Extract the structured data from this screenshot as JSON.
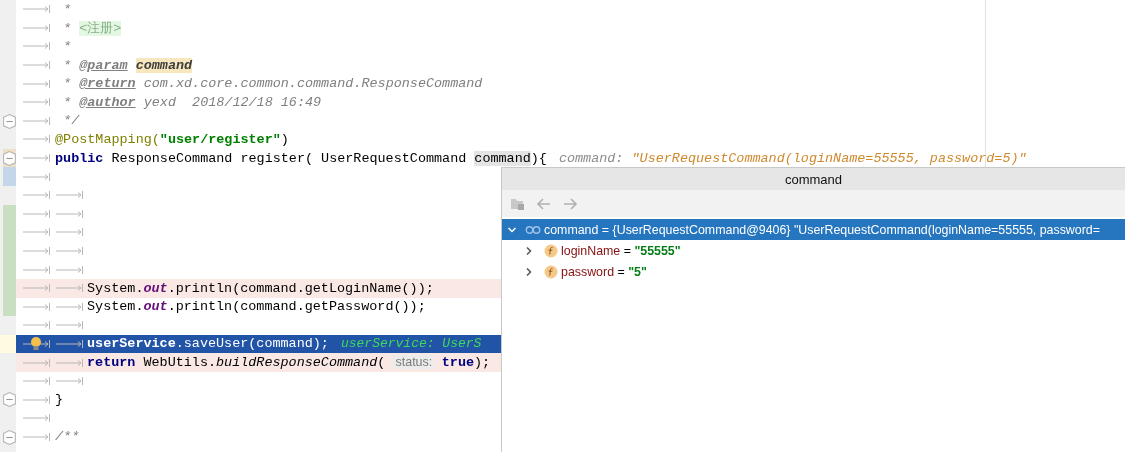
{
  "editor": {
    "lines": [
      {
        "kind": "top",
        "tokens": [
          {
            "text": " *",
            "kind": "comment"
          }
        ]
      },
      {
        "kind": "top",
        "tokens": [
          {
            "text": " * ",
            "kind": "comment"
          },
          {
            "text": "<注册>",
            "kind": "html"
          }
        ]
      },
      {
        "kind": "top",
        "tokens": [
          {
            "text": " *",
            "kind": "comment"
          }
        ]
      },
      {
        "kind": "top",
        "tokens": [
          {
            "text": " * ",
            "kind": "comment"
          },
          {
            "text": "@param",
            "kind": "doctag"
          },
          {
            "text": "command",
            "kind": "docparam"
          }
        ]
      },
      {
        "kind": "top",
        "tokens": [
          {
            "text": " * ",
            "kind": "comment"
          },
          {
            "text": "@return",
            "kind": "doctag"
          },
          {
            "text": " com.xd.core.common.command.ResponseCommand",
            "kind": "comment"
          }
        ]
      },
      {
        "kind": "top",
        "tokens": [
          {
            "text": " * ",
            "kind": "comment"
          },
          {
            "text": "@author",
            "kind": "doctag"
          },
          {
            "text": " yexd  2018/12/18 16:49",
            "kind": "comment"
          }
        ]
      },
      {
        "kind": "top",
        "fold": true,
        "tokens": [
          {
            "text": " */",
            "kind": "comment"
          }
        ]
      },
      {
        "kind": "top",
        "tokens": [
          {
            "text": "@PostMapping(",
            "kind": "annotation"
          },
          {
            "text": "\"user/register\"",
            "kind": "string"
          },
          {
            "text": ")",
            "kind": "plain"
          }
        ]
      },
      {
        "kind": "top",
        "color": "#ede0c4",
        "fold": true,
        "tokens": [
          {
            "text": "public",
            "kind": "keyword"
          },
          {
            "text": " ResponseCommand register( UserRequestCommand ",
            "kind": "plain"
          },
          {
            "text": "command",
            "kind": "usage"
          },
          {
            "text": "){",
            "kind": "plain"
          }
        ],
        "hint": [
          {
            "text": "command: ",
            "kind": "hint-name"
          },
          {
            "text": "\"UserRequestCommand(loginName=55555, password=5)\"",
            "kind": "hint-value"
          }
        ]
      },
      {
        "kind": "top",
        "color": "#c3d6ea"
      },
      {
        "kind": "body"
      },
      {
        "kind": "body",
        "color": "#c8dfc2"
      },
      {
        "kind": "body",
        "color": "#c8dfc2"
      },
      {
        "kind": "body",
        "color": "#c8dfc2"
      },
      {
        "kind": "body",
        "color": "#c8dfc2"
      },
      {
        "kind": "body",
        "color": "#c8dfc2",
        "breakpoint": true,
        "tokens": [
          {
            "text": "System.",
            "kind": "plain"
          },
          {
            "text": "out",
            "kind": "static"
          },
          {
            "text": ".println(command.getLoginName());",
            "kind": "plain"
          }
        ]
      },
      {
        "kind": "body",
        "color": "#c8dfc2",
        "tokens": [
          {
            "text": "System.",
            "kind": "plain"
          },
          {
            "text": "out",
            "kind": "static"
          },
          {
            "text": ".println(command.getPassword());",
            "kind": "plain"
          }
        ]
      },
      {
        "kind": "body"
      },
      {
        "kind": "body",
        "bulb": true,
        "execution_point": true,
        "tokens": [
          {
            "text": "userService",
            "kind": "field"
          },
          {
            "text": ".saveUser(command);",
            "kind": "plain"
          }
        ],
        "hint": [
          {
            "text": "userService: UserS",
            "kind": "hint-green"
          }
        ]
      },
      {
        "kind": "body",
        "breakpoint": true,
        "tokens": [
          {
            "text": "return",
            "kind": "keyword"
          },
          {
            "text": " WebUtils.",
            "kind": "plain"
          },
          {
            "text": "buildResponseCommand",
            "kind": "italic"
          },
          {
            "text": "( ",
            "kind": "plain"
          },
          {
            "text": "status:",
            "kind": "paramhint"
          },
          {
            "text": "true",
            "kind": "keyword"
          },
          {
            "text": ");",
            "kind": "plain"
          }
        ]
      },
      {
        "kind": "body"
      },
      {
        "kind": "top",
        "fold": true,
        "tokens": [
          {
            "text": "}",
            "kind": "plain"
          }
        ]
      },
      {
        "kind": "top"
      },
      {
        "kind": "top",
        "fold": true,
        "tokens": [
          {
            "text": "/**",
            "kind": "comment"
          }
        ]
      }
    ]
  },
  "popup": {
    "title": "command",
    "nodes": [
      {
        "name": "command",
        "op": "=",
        "value": "{UserRequestCommand@9406} \"UserRequestCommand(loginName=55555, password=",
        "kind": "object",
        "expanded": true,
        "selected": true,
        "children": [
          {
            "name": "loginName",
            "op": "=",
            "value": "\"55555\"",
            "kind": "field",
            "expanded": false,
            "selected": false
          },
          {
            "name": "password",
            "op": "=",
            "value": "\"5\"",
            "kind": "field",
            "expanded": false,
            "selected": false
          }
        ]
      }
    ]
  }
}
